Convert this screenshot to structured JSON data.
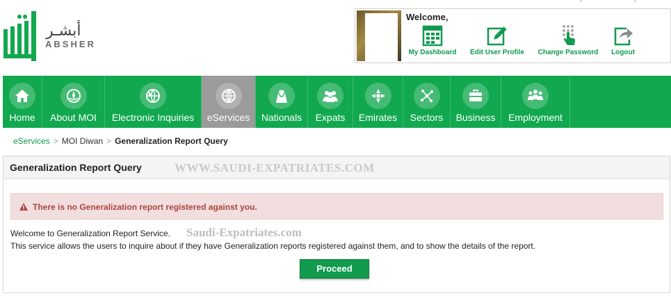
{
  "header": {
    "logo_arabic": "أبشـر",
    "logo_english": "ABSHER",
    "welcome": "Welcome,",
    "quick_links": [
      {
        "label": "My Dashboard",
        "icon": "dashboard-icon"
      },
      {
        "label": "Edit User Profile",
        "icon": "edit-profile-icon"
      },
      {
        "label": "Change Password",
        "icon": "change-password-icon"
      },
      {
        "label": "Logout",
        "icon": "logout-icon"
      }
    ]
  },
  "nav": {
    "items": [
      {
        "label": "Home",
        "icon": "home-icon",
        "active": false
      },
      {
        "label": "About MOI",
        "icon": "moi-emblem-icon",
        "active": false
      },
      {
        "label": "Electronic Inquiries",
        "icon": "inquiries-icon",
        "active": false
      },
      {
        "label": "eServices",
        "icon": "globe-icon",
        "active": true
      },
      {
        "label": "Nationals",
        "icon": "nationals-icon",
        "active": false
      },
      {
        "label": "Expats",
        "icon": "expats-icon",
        "active": false
      },
      {
        "label": "Emirates",
        "icon": "emirates-icon",
        "active": false
      },
      {
        "label": "Sectors",
        "icon": "sectors-icon",
        "active": false
      },
      {
        "label": "Business",
        "icon": "briefcase-icon",
        "active": false
      },
      {
        "label": "Employment",
        "icon": "employment-icon",
        "active": false
      }
    ]
  },
  "breadcrumb": {
    "items": [
      "eServices",
      "MOI Diwan",
      "Generalization Report Query"
    ],
    "separator": ">"
  },
  "panel": {
    "title": "Generalization Report Query",
    "watermark_top": "WWW.SAUDI-EXPATRIATES.COM",
    "alert": "There is no Generalization report registered against you.",
    "intro_line1": "Welcome to Generalization Report Service.",
    "watermark_mid": "Saudi-Expatriates.com",
    "intro_line2": "This service allows the users to inquire about if they have Generalization reports registered against them, and to show the details of the report.",
    "proceed_label": "Proceed"
  },
  "colors": {
    "brand_green": "#11a84f",
    "link_green": "#129a4e",
    "active_tab": "#9b9b9b",
    "alert_bg": "#f2dede",
    "alert_text": "#a94442"
  }
}
